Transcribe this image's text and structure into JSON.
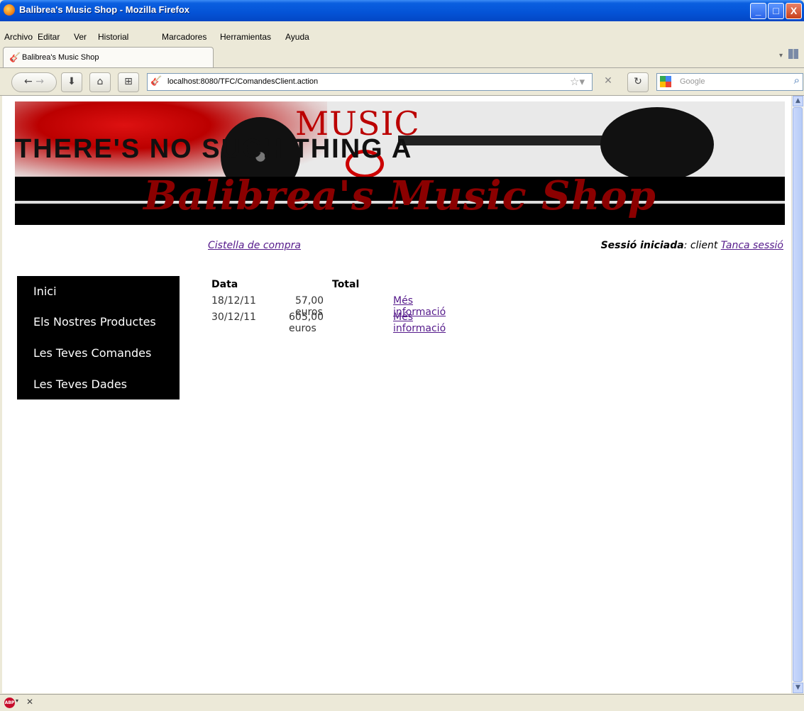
{
  "window": {
    "title": "Balibrea's Music Shop - Mozilla Firefox",
    "buttons": {
      "minimize": "_",
      "maximize": "□",
      "close": "X"
    }
  },
  "menu": [
    "Archivo",
    "Editar",
    "Ver",
    "Historial",
    "Marcadores",
    "Herramientas",
    "Ayuda"
  ],
  "tab": {
    "label": "Balibrea's Music Shop"
  },
  "urlbar": {
    "url": "localhost:8080/TFC/ComandesClient.action"
  },
  "search": {
    "placeholder": "Google"
  },
  "banner": {
    "music_word": "MUSIC",
    "tagline": "THERE'S NO SUCH THING A",
    "brand": "Balibrea's Music Shop"
  },
  "header": {
    "cart_link": "Cistella de compra",
    "session_label": "Sessió iniciada",
    "session_user": ": client ",
    "logout_link": "Tanca sessió"
  },
  "sidebar": {
    "items": [
      {
        "label": "Inici"
      },
      {
        "label": "Els Nostres Productes"
      },
      {
        "label": "Les Teves Comandes"
      },
      {
        "label": "Les Teves Dades"
      }
    ]
  },
  "orders": {
    "headers": {
      "date": "Data",
      "total": "Total"
    },
    "rows": [
      {
        "date": "18/12/11",
        "total": "57,00 euros",
        "link": "Més informació"
      },
      {
        "date": "30/12/11",
        "total": "605,00 euros",
        "link": "Més informació"
      }
    ]
  },
  "colors": {
    "titlebar": "#0453d6",
    "sidebar_bg": "#000000",
    "link": "#551a8b",
    "brand_red": "#8b0000"
  }
}
